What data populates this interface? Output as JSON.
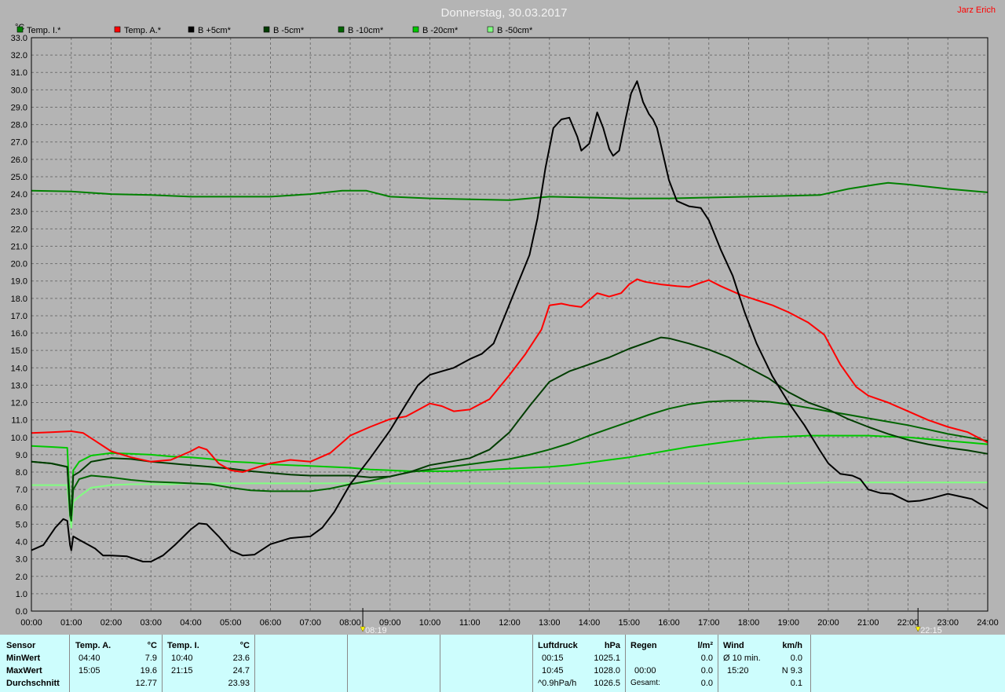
{
  "title": "Donnerstag, 30.03.2017",
  "author": "Jarz Erich",
  "colors": {
    "background": "#b4b4b4",
    "stats_bg": "#cdfdfd",
    "title": "#f2f2f2",
    "author": "#ff0000"
  },
  "sunrise": {
    "time": "08:19",
    "hour": 8.3167
  },
  "sunset": {
    "time": "22:15",
    "hour": 22.25
  },
  "chart_data": {
    "type": "line",
    "ylabel": "°C",
    "ylim": [
      0,
      33
    ],
    "xlim": [
      0,
      24
    ],
    "grid": true,
    "legend_position": "top-left",
    "yticks": [
      "0.0",
      "1.0",
      "2.0",
      "3.0",
      "4.0",
      "5.0",
      "6.0",
      "7.0",
      "8.0",
      "9.0",
      "10.0",
      "11.0",
      "12.0",
      "13.0",
      "14.0",
      "15.0",
      "16.0",
      "17.0",
      "18.0",
      "19.0",
      "20.0",
      "21.0",
      "22.0",
      "23.0",
      "24.0",
      "25.0",
      "26.0",
      "27.0",
      "28.0",
      "29.0",
      "30.0",
      "31.0",
      "32.0",
      "33.0"
    ],
    "xticks": [
      "00:00",
      "01:00",
      "02:00",
      "03:00",
      "04:00",
      "05:00",
      "06:00",
      "07:00",
      "08:00",
      "09:00",
      "10:00",
      "11:00",
      "12:00",
      "13:00",
      "14:00",
      "15:00",
      "16:00",
      "17:00",
      "18:00",
      "19:00",
      "20:00",
      "21:00",
      "22:00",
      "23:00",
      "24:00"
    ],
    "series": [
      {
        "name": "Temp. I.*",
        "color": "#008000",
        "x": [
          0,
          1,
          2,
          3,
          4,
          5,
          6,
          7,
          7.8,
          8.4,
          9,
          10,
          11,
          12,
          13,
          14,
          15,
          16,
          17,
          18,
          19,
          19.8,
          20.5,
          21.2,
          21.5,
          22,
          23,
          24
        ],
        "y": [
          24.2,
          24.15,
          24.0,
          23.95,
          23.85,
          23.85,
          23.85,
          24.0,
          24.2,
          24.2,
          23.85,
          23.75,
          23.7,
          23.65,
          23.85,
          23.8,
          23.75,
          23.75,
          23.8,
          23.85,
          23.9,
          23.95,
          24.3,
          24.55,
          24.65,
          24.55,
          24.3,
          24.1
        ]
      },
      {
        "name": "Temp. A.*",
        "color": "#ff0000",
        "x": [
          0,
          0.5,
          1,
          1.3,
          1.6,
          2,
          2.5,
          3,
          3.5,
          4,
          4.2,
          4.4,
          4.7,
          5,
          5.3,
          5.7,
          6,
          6.5,
          7,
          7.5,
          8,
          8.5,
          9,
          9.4,
          9.8,
          10,
          10.3,
          10.6,
          11,
          11.5,
          12,
          12.4,
          12.8,
          13,
          13.3,
          13.5,
          13.8,
          14,
          14.2,
          14.5,
          14.8,
          15,
          15.2,
          15.4,
          15.8,
          16.2,
          16.5,
          16.8,
          17,
          17.3,
          17.8,
          18.2,
          18.6,
          19,
          19.5,
          19.9,
          20.3,
          20.7,
          21,
          21.5,
          22,
          22.5,
          23,
          23.5,
          24
        ],
        "y": [
          10.25,
          10.3,
          10.35,
          10.25,
          9.8,
          9.2,
          8.85,
          8.6,
          8.7,
          9.2,
          9.45,
          9.3,
          8.5,
          8.1,
          8.0,
          8.3,
          8.5,
          8.7,
          8.6,
          9.1,
          10.1,
          10.6,
          11.05,
          11.2,
          11.7,
          11.95,
          11.8,
          11.5,
          11.6,
          12.2,
          13.6,
          14.8,
          16.2,
          17.6,
          17.7,
          17.6,
          17.5,
          17.9,
          18.3,
          18.1,
          18.3,
          18.8,
          19.1,
          18.95,
          18.8,
          18.7,
          18.65,
          18.9,
          19.05,
          18.7,
          18.2,
          17.9,
          17.6,
          17.2,
          16.6,
          15.9,
          14.2,
          12.9,
          12.4,
          12.0,
          11.5,
          11.0,
          10.6,
          10.3,
          9.7
        ]
      },
      {
        "name": "B +5cm*",
        "color": "#000000",
        "x": [
          0,
          0.3,
          0.6,
          0.8,
          0.9,
          0.97,
          1.0,
          1.05,
          1.2,
          1.6,
          1.8,
          2,
          2.4,
          2.8,
          3,
          3.3,
          3.6,
          4,
          4.2,
          4.4,
          4.7,
          5,
          5.3,
          5.6,
          6,
          6.5,
          7,
          7.3,
          7.6,
          8,
          8.5,
          9,
          9.4,
          9.7,
          10,
          10.3,
          10.6,
          11,
          11.3,
          11.6,
          11.9,
          12.2,
          12.5,
          12.7,
          12.9,
          13.1,
          13.3,
          13.5,
          13.7,
          13.8,
          14,
          14.1,
          14.2,
          14.35,
          14.5,
          14.6,
          14.75,
          14.9,
          15.05,
          15.2,
          15.35,
          15.5,
          15.6,
          15.7,
          15.85,
          16,
          16.2,
          16.5,
          16.8,
          17,
          17.3,
          17.6,
          17.9,
          18.2,
          18.6,
          19,
          19.4,
          19.8,
          20,
          20.3,
          20.6,
          20.8,
          21,
          21.3,
          21.6,
          22,
          22.3,
          22.6,
          23,
          23.3,
          23.6,
          24
        ],
        "y": [
          3.5,
          3.8,
          4.8,
          5.3,
          5.2,
          3.8,
          3.5,
          4.3,
          4.1,
          3.6,
          3.2,
          3.2,
          3.15,
          2.85,
          2.85,
          3.2,
          3.8,
          4.7,
          5.05,
          5.0,
          4.3,
          3.5,
          3.2,
          3.25,
          3.85,
          4.2,
          4.3,
          4.8,
          5.7,
          7.3,
          8.8,
          10.4,
          11.9,
          13.0,
          13.6,
          13.8,
          14.0,
          14.5,
          14.8,
          15.4,
          17.1,
          18.8,
          20.5,
          22.6,
          25.5,
          27.8,
          28.3,
          28.4,
          27.3,
          26.5,
          26.9,
          27.8,
          28.7,
          27.8,
          26.6,
          26.2,
          26.5,
          28.2,
          29.8,
          30.5,
          29.3,
          28.6,
          28.3,
          27.8,
          26.3,
          24.8,
          23.6,
          23.3,
          23.2,
          22.5,
          20.8,
          19.3,
          17.2,
          15.4,
          13.5,
          12.0,
          10.7,
          9.2,
          8.5,
          7.9,
          7.8,
          7.6,
          7.0,
          6.8,
          6.75,
          6.3,
          6.35,
          6.5,
          6.75,
          6.6,
          6.45,
          5.9
        ]
      },
      {
        "name": "B -5cm*",
        "color": "#003c00",
        "x": [
          0,
          0.5,
          0.9,
          0.97,
          1.0,
          1.05,
          1.2,
          1.5,
          2,
          2.5,
          3,
          3.5,
          4,
          4.5,
          5,
          5.5,
          6,
          6.5,
          7,
          7.5,
          8,
          8.5,
          9,
          9.5,
          10,
          10.5,
          11,
          11.5,
          12,
          12.5,
          13,
          13.5,
          14,
          14.5,
          15,
          15.5,
          15.8,
          16,
          16.5,
          17,
          17.5,
          18,
          18.5,
          19,
          19.5,
          20,
          20.5,
          21,
          21.5,
          22,
          22.5,
          23,
          23.5,
          24
        ],
        "y": [
          8.6,
          8.5,
          8.3,
          5.8,
          5.5,
          7.8,
          8.0,
          8.6,
          8.8,
          8.75,
          8.6,
          8.5,
          8.4,
          8.3,
          8.2,
          8.05,
          7.95,
          7.85,
          7.8,
          7.8,
          7.8,
          7.7,
          7.75,
          8.0,
          8.4,
          8.6,
          8.8,
          9.3,
          10.3,
          11.8,
          13.2,
          13.8,
          14.2,
          14.6,
          15.1,
          15.5,
          15.75,
          15.7,
          15.4,
          15.05,
          14.6,
          14.0,
          13.4,
          12.6,
          12.0,
          11.6,
          11.05,
          10.6,
          10.2,
          9.85,
          9.6,
          9.4,
          9.25,
          9.05
        ]
      },
      {
        "name": "B -10cm*",
        "color": "#006400",
        "x": [
          0,
          0.5,
          0.9,
          0.97,
          1.0,
          1.05,
          1.2,
          1.5,
          2,
          2.5,
          3,
          3.5,
          4,
          4.5,
          5,
          5.5,
          6,
          6.5,
          7,
          7.5,
          8,
          8.5,
          9,
          9.5,
          10,
          10.5,
          11,
          11.5,
          12,
          12.5,
          13,
          13.5,
          14,
          14.5,
          15,
          15.5,
          16,
          16.5,
          17,
          17.5,
          18,
          18.5,
          19,
          19.5,
          20,
          20.5,
          21,
          21.5,
          22,
          22.5,
          23,
          23.5,
          24
        ],
        "y": [
          8.6,
          8.5,
          8.3,
          5.5,
          5.2,
          7.0,
          7.6,
          7.8,
          7.7,
          7.55,
          7.45,
          7.4,
          7.35,
          7.3,
          7.1,
          6.95,
          6.9,
          6.9,
          6.9,
          7.05,
          7.3,
          7.5,
          7.75,
          8.0,
          8.15,
          8.3,
          8.45,
          8.6,
          8.75,
          9.0,
          9.3,
          9.65,
          10.1,
          10.5,
          10.9,
          11.3,
          11.65,
          11.9,
          12.05,
          12.1,
          12.1,
          12.05,
          11.9,
          11.7,
          11.5,
          11.3,
          11.1,
          10.9,
          10.7,
          10.45,
          10.2,
          10.0,
          9.8
        ]
      },
      {
        "name": "B -20cm*",
        "color": "#00c800",
        "x": [
          0,
          0.5,
          0.9,
          0.97,
          1.0,
          1.05,
          1.2,
          1.5,
          2,
          2.5,
          3,
          3.5,
          4,
          4.5,
          5,
          5.5,
          6,
          6.5,
          7,
          7.5,
          8,
          8.5,
          9,
          9.5,
          10,
          10.5,
          11,
          11.5,
          12,
          12.5,
          13,
          13.5,
          14,
          14.5,
          15,
          15.5,
          16,
          16.5,
          17,
          17.5,
          18,
          18.5,
          19,
          19.5,
          20,
          20.5,
          21,
          21.5,
          22,
          22.5,
          23,
          23.5,
          24
        ],
        "y": [
          9.5,
          9.45,
          9.4,
          6.0,
          5.5,
          8.1,
          8.6,
          8.95,
          9.1,
          9.05,
          9.0,
          8.9,
          8.85,
          8.75,
          8.6,
          8.55,
          8.45,
          8.4,
          8.35,
          8.3,
          8.25,
          8.15,
          8.1,
          8.05,
          8.05,
          8.05,
          8.1,
          8.15,
          8.2,
          8.25,
          8.3,
          8.4,
          8.55,
          8.7,
          8.85,
          9.05,
          9.25,
          9.45,
          9.6,
          9.75,
          9.9,
          10.0,
          10.05,
          10.1,
          10.1,
          10.1,
          10.1,
          10.05,
          10.0,
          9.9,
          9.8,
          9.7,
          9.6
        ]
      },
      {
        "name": "B -50cm*",
        "color": "#80ff80",
        "x": [
          0,
          0.5,
          0.9,
          0.97,
          1.0,
          1.05,
          1.2,
          1.5,
          2,
          2.5,
          3,
          3.5,
          4,
          5,
          6,
          7,
          8,
          9,
          10,
          11,
          12,
          13,
          14,
          15,
          16,
          17,
          18,
          19,
          20,
          21,
          22,
          23,
          24
        ],
        "y": [
          7.25,
          7.25,
          7.25,
          5.4,
          4.8,
          6.3,
          6.6,
          7.1,
          7.25,
          7.3,
          7.3,
          7.3,
          7.35,
          7.35,
          7.35,
          7.35,
          7.35,
          7.35,
          7.35,
          7.35,
          7.35,
          7.35,
          7.35,
          7.35,
          7.35,
          7.35,
          7.35,
          7.35,
          7.4,
          7.4,
          7.4,
          7.4,
          7.4
        ]
      }
    ]
  },
  "stats": {
    "sensor_header": "Sensor",
    "row_labels": [
      "MinWert",
      "MaxWert",
      "Durchschnitt"
    ],
    "temp_a": {
      "header": "Temp. A.",
      "unit": "°C",
      "min_time": "04:40",
      "min_val": "7.9",
      "max_time": "15:05",
      "max_val": "19.6",
      "avg": "12.77"
    },
    "temp_i": {
      "header": "Temp. I.",
      "unit": "°C",
      "min_time": "10:40",
      "min_val": "23.6",
      "max_time": "21:15",
      "max_val": "24.7",
      "avg": "23.93"
    },
    "pressure": {
      "header": "Luftdruck",
      "unit": "hPa",
      "min_time": "00:15",
      "min_val": "1025.1",
      "max_time": "10:45",
      "max_val": "1028.0",
      "trend_label": "^0.9hPa/h",
      "avg": "1026.5"
    },
    "rain": {
      "header": "Regen",
      "unit": "l/m²",
      "row2_time": "00:00",
      "row2_val": "0.0",
      "row1_val": "0.0",
      "total_label": "Gesamt:",
      "total_val": "0.0"
    },
    "wind": {
      "header": "Wind",
      "unit": "km/h",
      "avg_label": "Ø 10 min.",
      "avg_val": "0.0",
      "max_time": "15:20",
      "max_val": "N 9.3",
      "row3_val": "0.1"
    }
  }
}
